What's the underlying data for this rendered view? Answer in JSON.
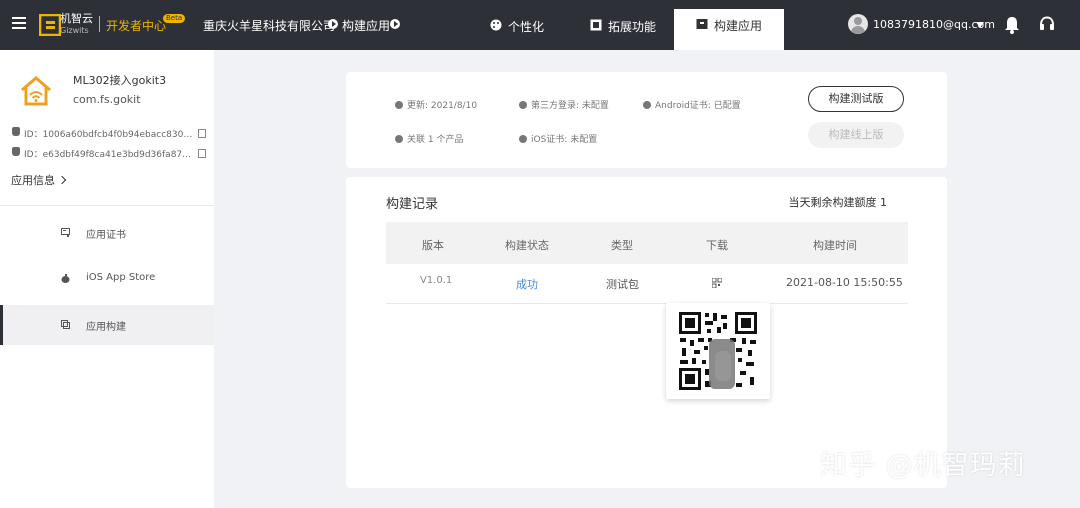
{
  "topbar": {
    "logo_text": "机智云",
    "logo_sub": "Gizwits",
    "dev_center": "开发者中心",
    "beta": "Beta",
    "company": "重庆火羊星科技有限公司",
    "crumb": "构建应用",
    "tabs": [
      {
        "label": "个性化",
        "icon": "palette-icon"
      },
      {
        "label": "拓展功能",
        "icon": "puzzle-icon"
      },
      {
        "label": "构建应用",
        "icon": "box-icon",
        "active": true
      }
    ],
    "user_email": "1083791810@qq.com"
  },
  "sidebar": {
    "app_name": "ML302接入gokit3",
    "package": "com.fs.gokit",
    "ios_id": "ID：1006a60bdfcb4f0b94ebacc8300a...",
    "android_id": "ID：e63dbf49f8ca41e3bd9d36fa8738...",
    "app_info": "应用信息",
    "items": [
      {
        "label": "应用证书",
        "icon": "certificate-icon"
      },
      {
        "label": "iOS App Store",
        "icon": "apple-icon"
      },
      {
        "label": "应用构建",
        "icon": "build-icon",
        "active": true
      }
    ]
  },
  "summary": {
    "updated": "更新: 2021/8/10",
    "third_login": "第三方登录: 未配置",
    "android_cert": "Android证书: 已配置",
    "related": "关联 1 个产品",
    "ios_cert": "iOS证书: 未配置",
    "btn_test": "构建测试版",
    "btn_live": "构建线上版"
  },
  "records": {
    "title": "构建记录",
    "quota": "当天剩余构建额度 1",
    "headers": [
      "版本",
      "构建状态",
      "类型",
      "下载",
      "构建时间"
    ],
    "rows": [
      {
        "version": "V1.0.1",
        "status": "成功",
        "type": "测试包",
        "time": "2021-08-10 15:50:55"
      }
    ]
  },
  "watermark": "知乎 @机智玛莉",
  "colors": {
    "topbar": "#2d3037",
    "accent": "#f0b400",
    "link": "#3d8ddc"
  }
}
